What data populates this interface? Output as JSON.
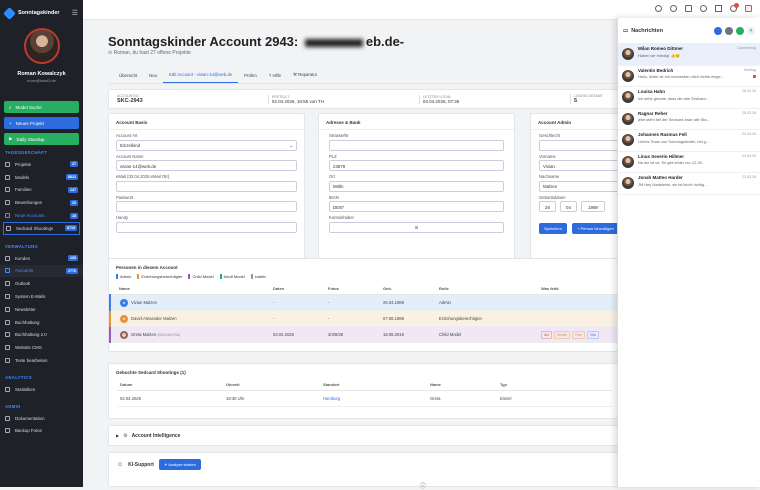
{
  "sidebar": {
    "brand": "Sonntagskinder",
    "user_name": "Roman Kowalczyk",
    "user_email": "mom@kowi3.de",
    "buttons": [
      {
        "label": "Model Suche",
        "color": "#27ae60"
      },
      {
        "label": "Neues Projekt",
        "color": "#2d6cdf"
      },
      {
        "label": "Daily Standup",
        "color": "#27ae60"
      }
    ],
    "section_1": "TAGESGESCHÄFT",
    "items_1": [
      {
        "label": "Projekte",
        "badge": "27"
      },
      {
        "label": "Models",
        "badge": "8812"
      },
      {
        "label": "Familien",
        "badge": "147"
      },
      {
        "label": "Bewerbungen",
        "badge": "20"
      },
      {
        "label": "Neue Accounts",
        "badge": "18"
      },
      {
        "label": "Sedcard Shootings",
        "badge": "8719"
      }
    ],
    "section_2": "VERWALTUNG",
    "items_2": [
      {
        "label": "Kunden",
        "badge": "105"
      },
      {
        "label": "Accounts",
        "badge": "2776"
      },
      {
        "label": "Outlook",
        "badge": ""
      },
      {
        "label": "System E-Mails",
        "badge": ""
      },
      {
        "label": "Newsletter",
        "badge": ""
      },
      {
        "label": "Buchhaltung",
        "badge": ""
      },
      {
        "label": "Buchhaltung 2.0",
        "badge": ""
      },
      {
        "label": "Website CMS",
        "badge": ""
      },
      {
        "label": "Texte bearbeiten",
        "badge": ""
      }
    ],
    "section_3": "ANALYTICS",
    "items_3": [
      {
        "label": "Statistiken",
        "badge": ""
      }
    ],
    "section_4": "ADMIN",
    "items_4": [
      {
        "label": "Dokumentation",
        "badge": ""
      },
      {
        "label": "Backup Fotos",
        "badge": ""
      }
    ]
  },
  "page": {
    "title_prefix": "Sonntagskinder Account 2943: ",
    "title_suffix": "eb.de-",
    "subtitle": "Roman, du hast 27 offene Projekte"
  },
  "tabs": [
    "Übersicht",
    "Neu",
    "Edit Account - vivian-14@web.de",
    "Prüfen",
    "Hilfe",
    "Reparatur"
  ],
  "info": [
    {
      "label": "ACCOUNT-ID",
      "value": "SKC-2943"
    },
    {
      "label": "ERSTELLT",
      "value": "02.04.2026, 18:56 von TH"
    },
    {
      "label": "LETZTER LOGIN",
      "value": "03.04.2026, 07:36"
    },
    {
      "label": "LOGINS GESAMT",
      "value": "5"
    }
  ],
  "basis": {
    "title": "Account Basis",
    "art_label": "Account Art",
    "art_value": "Einzelkind",
    "name_label": "Account Name",
    "name_value": "vivian-14@web.de",
    "emailok_label": "eMail (03.04.2026 eMail OK)",
    "passwort_label": "Passwort",
    "handy_label": "Handy"
  },
  "adresse": {
    "title": "Adresse & Bank",
    "strasse_label": "Strasse/Nr",
    "plz_label": "PLZ",
    "plz_value": "23879",
    "ort_label": "Ort",
    "ort_value": "Mölln",
    "iban_label": "IBAN",
    "iban_value": "DE87",
    "kontoinhaber_label": "Kontoinhaber",
    "kontoinhaber_value": "iri"
  },
  "admin": {
    "title": "Account Admin",
    "geschlecht_label": "Geschlecht",
    "vorname_label": "Vorname",
    "vorname_value": "Vivian",
    "nachname_label": "Nachname",
    "nachname_value": "Malzen",
    "geburtsdatum_label": "Geburtsdatum",
    "tag": "26",
    "monat": "04",
    "jahr": "1989",
    "save": "Speichern",
    "add_person": "Person hinzufügen"
  },
  "personen": {
    "title": "Personen in diesem Account",
    "filters": [
      "Admin",
      "Erziehungsberechtigter",
      "Child Model",
      "Adult Model",
      "inaktiv"
    ],
    "headers": [
      "Name",
      "Daten",
      "Fotos",
      "Geb.",
      "Rolle",
      "Was fehlt"
    ],
    "rows": [
      {
        "name": "Vivian Malzen",
        "daten": "-",
        "fotos": "-",
        "geb": "26.04.1989",
        "rolle": "Admin",
        "fehlt": ""
      },
      {
        "name": "David-Alexander Malzen",
        "daten": "-",
        "fotos": "-",
        "geb": "07.06.1989",
        "rolle": "Erziehungsberechtigter",
        "fehlt": ""
      },
      {
        "name": "Greta Malzen",
        "daten": "03.04.2026",
        "fotos": "3/4/8/28",
        "geb": "18.08.2019",
        "rolle": "Child Model",
        "fehlt": ""
      }
    ],
    "greta_id": "(SKC/1M-3 Rd)",
    "missing": [
      "Akt",
      "Schule",
      "Foto",
      "Vita"
    ]
  },
  "shootings": {
    "title": "Gebuchte Sedcard Shootings (1)",
    "headers": [
      "Datum",
      "Uhrzeit",
      "Standort",
      "Name",
      "Typ"
    ],
    "row": {
      "datum": "02.04.2026",
      "uhrzeit": "18:30 Uhr",
      "standort": "Hamburg",
      "name": "Greta",
      "typ": "Einzel"
    }
  },
  "intelligence": "Account Intelligence",
  "ki": {
    "title": "KI-Support",
    "button": "Analyse starten"
  },
  "chat": {
    "title": "Nachrichten",
    "items": [
      {
        "name": "Milan Romeo Dittmer",
        "date": "Donnerstag",
        "msg": "Haben wir erledigt 👍😊",
        "flag": false
      },
      {
        "name": "Valentin Bedrich",
        "date": "Montag",
        "msg": "Hallo, leider ist mir momentan nicht nichts einge…",
        "flag": true
      },
      {
        "name": "Louisa Hahn",
        "date": "26.03.26",
        "msg": "Ich sehe gerade, dass die alte Sedcard…",
        "flag": false
      },
      {
        "name": "Ragnar Reher",
        "date": "25.03.26",
        "msg": "jetzt steht bei der Sedcard zwar alle Sta…",
        "flag": false
      },
      {
        "name": "Johannes Rasmus Fell",
        "date": "24.03.26",
        "msg": "Liebes Team von Sonntagskinder, bei g…",
        "flag": false
      },
      {
        "name": "Linus Severin Hillmer",
        "date": "24.03.26",
        "msg": "Na die ist ok. Es gibt leider nur 12-25.",
        "flag": false
      },
      {
        "name": "Jonah Matteo Harder",
        "date": "23.03.26",
        "msg": "JM Hey Madeleine, sie ist leicht richtig…",
        "flag": false
      }
    ]
  },
  "colors": {
    "accent": "#2d6cdf",
    "green": "#27ae60",
    "sidebar_bg": "#1e2127",
    "danger": "#e74c3c"
  }
}
